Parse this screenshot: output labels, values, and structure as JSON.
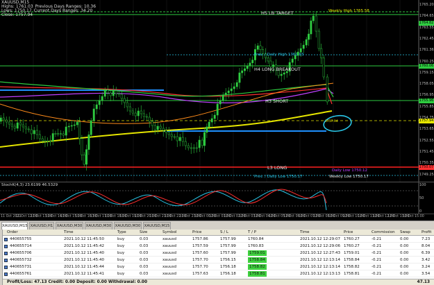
{
  "chart": {
    "symbol_line": "XAUUSD,M15",
    "info_lines": [
      [
        "Highs: 1761.03",
        "Previous Days Ranges: 10.36"
      ],
      [
        "Lows: 1750.17",
        "Current Days Ranges: 34.20"
      ],
      [
        "Close: 1757.94"
      ]
    ],
    "level_labels": {
      "h5": "H5 LB TARGET",
      "h4": "H4 LONG BREAKOUT",
      "h3": "H3 SHORT",
      "l3": "L3 LONG",
      "weekly_high": "Weekly High 1765.58",
      "prev_daily_high": "Prev. / Daily High 1761.03",
      "daily_low": "Daily Low 1750.12",
      "prev_daily_low": "Prev. / Daily Low 1750.17",
      "weekly_low": "Weekly Low 1750.17",
      "last": "1757.94"
    },
    "price_axis": [
      "1765.20",
      "1764.65",
      "1763.55",
      "1762.45",
      "1761.36",
      "1760.25",
      "1759.15",
      "1758.05",
      "1756.95",
      "1755.85",
      "1754.75",
      "1753.65",
      "1752.55",
      "1751.45",
      "1750.35",
      "1749.25"
    ],
    "price_tags": [
      {
        "text": "1764.82",
        "color": "#2ecc40"
      },
      {
        "text": "1760.06",
        "color": "#2ecc40"
      },
      {
        "text": "1757.94",
        "color": "#e6e600"
      },
      {
        "text": "1755.96",
        "color": "#2ecc40"
      },
      {
        "text": "1750.07",
        "color": "#ff3030"
      }
    ],
    "time_axis": [
      "11 Oct 2021",
      "11 Oct 12:00",
      "11 Oct 13:00",
      "11 Oct 14:00",
      "11 Oct 15:00",
      "11 Oct 16:30",
      "11 Oct 17:00",
      "11 Oct 18:00",
      "11 Oct 19:00",
      "11 Oct 20:00",
      "11 Oct 21:00",
      "11 Oct 22:00",
      "11 Oct 23:00",
      "12 Oct 00:00",
      "12 Oct 01:00",
      "12 Oct 02:00",
      "12 Oct 03:00",
      "12 Oct 04:00",
      "12 Oct 05:00",
      "12 Oct 06:00",
      "12 Oct 07:00",
      "12 Oct 08:00",
      "12 Oct 09:00",
      "12 Oct 10:00",
      "12 Oct 11:00",
      "12 Oct 12:00",
      "12 Oct 13:00",
      "12 Oct 15:00"
    ],
    "colors": {
      "green_level": "#2ecc40",
      "yellow_ma": "#e6e600",
      "blue_line": "#1e90ff",
      "red_level": "#ff2020",
      "cyan_circle": "#29c5e6"
    }
  },
  "oscillator": {
    "label": "StochK(4,3) 23.6199 46.5329",
    "axis": [
      "100",
      "50",
      "0"
    ]
  },
  "tabs": [
    {
      "label": "XAUUSD,M15",
      "active": true
    },
    {
      "label": "XAUUSD,H1",
      "active": false
    },
    {
      "label": "XAUUSD,M30",
      "active": false
    },
    {
      "label": "XAUUSD,M30",
      "active": false
    },
    {
      "label": "XAUUSD,M30",
      "active": false
    },
    {
      "label": "XAUUSD,M15",
      "active": false
    }
  ],
  "terminal": {
    "headers": [
      "Order",
      "Time",
      "Type",
      "Size",
      "Symbol",
      "Price",
      "S / L",
      "T / P",
      "Time",
      "Price",
      "Commission",
      "Swap",
      "Profit"
    ],
    "rows": [
      [
        "440655755",
        "2021.10.12 11:45:50",
        "buy",
        "0.03",
        "xauusd",
        "1757.86",
        "1757.99",
        "1760.84",
        "2021.10.12 12:29:07",
        "1760.27",
        "-0.21",
        "0.00",
        "7.23"
      ],
      [
        "440655714",
        "2021.10.12 11:45:42",
        "buy",
        "0.03",
        "xauusd",
        "1757.59",
        "1757.99",
        "1760.83",
        "2021.10.12 12:29:06",
        "1760.27",
        "-0.21",
        "0.00",
        "8.04"
      ],
      [
        "440655706",
        "2021.10.12 11:45:40",
        "buy",
        "0.03",
        "xauusd",
        "1757.60",
        "1757.99",
        "1759.01",
        "2021.10.12 12:27:43",
        "1759.01",
        "-0.21",
        "0.00",
        "6.39"
      ],
      [
        "440655732",
        "2021.10.12 11:45:40",
        "buy",
        "0.03",
        "xauusd",
        "1757.70",
        "1756.15",
        "1758.84",
        "2021.10.12 12:13:14",
        "1758.84",
        "-0.21",
        "0.00",
        "3.42"
      ],
      [
        "440655731",
        "2021.10.12 11:45:44",
        "buy",
        "0.03",
        "xauusd",
        "1757.70",
        "1756.18",
        "1758.82",
        "2021.10.12 12:13:14",
        "1758.82",
        "-0.21",
        "0.00",
        "3.24"
      ],
      [
        "440655761",
        "2021.10.12 11:45:41",
        "buy",
        "0.03",
        "xauusd",
        "1757.63",
        "1756.18",
        "1758.81",
        "2021.10.12 12:13:13",
        "1758.81",
        "-0.21",
        "0.00",
        "3.54"
      ]
    ],
    "footer": "Profit/Loss: 47.13  Credit: 0.00  Deposit: 0.00  Withdrawal: 0.00",
    "total": "47.13"
  }
}
